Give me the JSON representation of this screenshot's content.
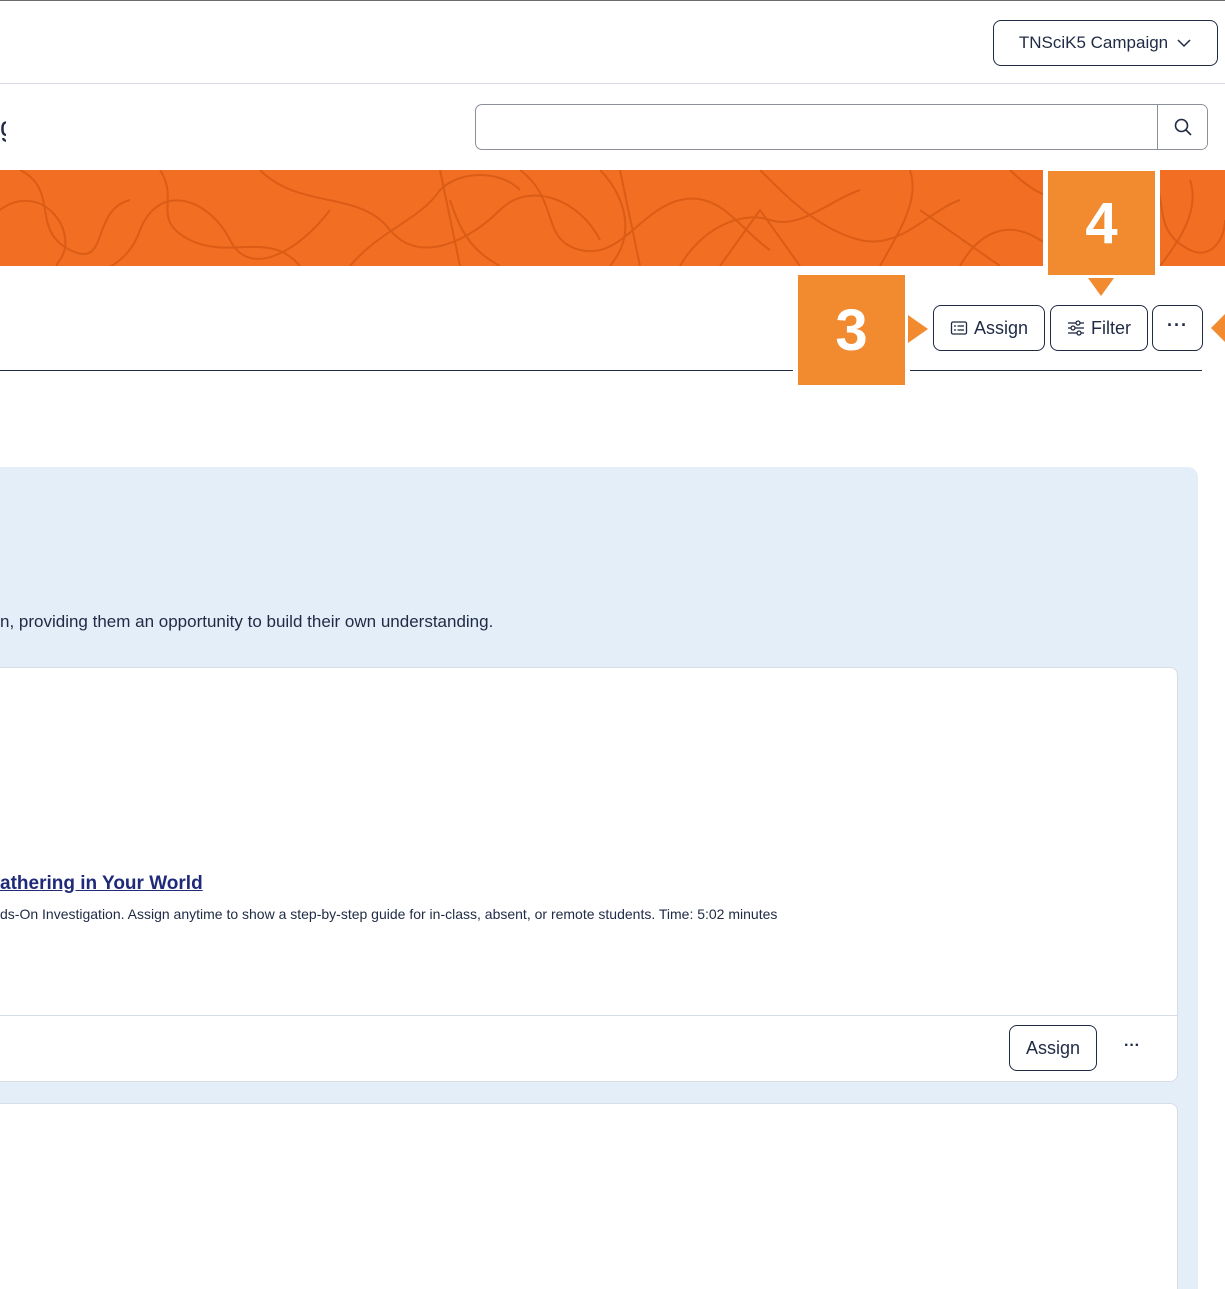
{
  "header": {
    "campaign_label": "TNSciK5 Campaign",
    "title_fragment": "g"
  },
  "search": {
    "value": "",
    "placeholder": ""
  },
  "toolbar": {
    "assign_label": "Assign",
    "filter_label": "Filter",
    "more_label": "···"
  },
  "callouts": {
    "three": "3",
    "four": "4"
  },
  "panel": {
    "description": "n, providing them an opportunity to build their own understanding."
  },
  "card": {
    "link_text": "athering in Your World",
    "description": "ds-On Investigation. Assign anytime to show a step-by-step guide for in-class, absent, or remote students. Time: 5:02 minutes",
    "assign_label": "Assign",
    "more_label": "···"
  },
  "colors": {
    "banner": "#f26e23",
    "callout": "#f28b30",
    "navy": "#1f2a44",
    "panel_bg": "#e4eef8"
  },
  "icons": {
    "campaign_dropdown": "chevron-down-icon",
    "search": "search-icon",
    "assign": "list-icon",
    "filter": "sliders-icon"
  }
}
